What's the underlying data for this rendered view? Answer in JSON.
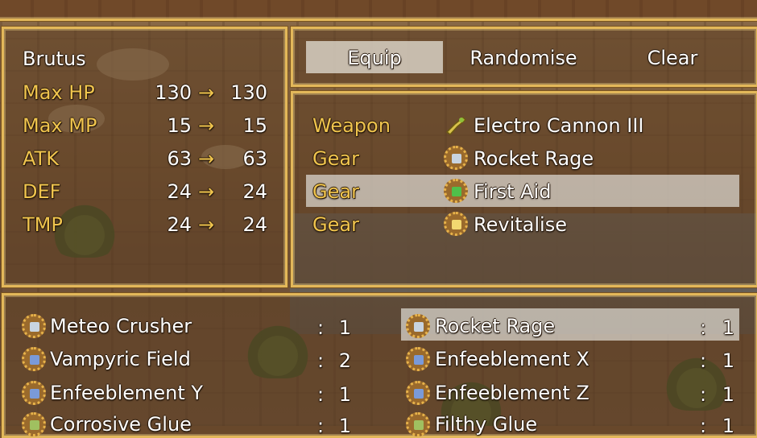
{
  "actor": {
    "name": "Brutus",
    "stats": [
      {
        "label": "Max HP",
        "current": "130",
        "arrow": "→",
        "new": "130"
      },
      {
        "label": "Max MP",
        "current": "15",
        "arrow": "→",
        "new": "15"
      },
      {
        "label": "ATK",
        "current": "63",
        "arrow": "→",
        "new": "63"
      },
      {
        "label": "DEF",
        "current": "24",
        "arrow": "→",
        "new": "24"
      },
      {
        "label": "TMP",
        "current": "24",
        "arrow": "→",
        "new": "24"
      }
    ]
  },
  "commands": [
    {
      "label": "Equip",
      "selected": true
    },
    {
      "label": "Randomise"
    },
    {
      "label": "Clear"
    }
  ],
  "slots": [
    {
      "slot": "Weapon",
      "item": "Electro Cannon III",
      "icon": "blaster-icon"
    },
    {
      "slot": "Gear",
      "item": "Rocket Rage",
      "icon": "gear-shield-icon"
    },
    {
      "slot": "Gear",
      "item": "First Aid",
      "icon": "gear-cross-icon",
      "selected": true
    },
    {
      "slot": "Gear",
      "item": "Revitalise",
      "icon": "gear-heal-icon"
    }
  ],
  "inventory": [
    {
      "name": "Meteo Crusher",
      "sep": ":",
      "qty": "1",
      "icon": "gear-shield-icon"
    },
    {
      "name": "Rocket Rage",
      "sep": ":",
      "qty": "1",
      "icon": "gear-shield-icon",
      "selected": true
    },
    {
      "name": "Vampyric Field",
      "sep": ":",
      "qty": "2",
      "icon": "gear-swirl-icon"
    },
    {
      "name": "Enfeeblement X",
      "sep": ":",
      "qty": "1",
      "icon": "gear-swirl-icon"
    },
    {
      "name": "Enfeeblement Y",
      "sep": ":",
      "qty": "1",
      "icon": "gear-swirl-icon"
    },
    {
      "name": "Enfeeblement Z",
      "sep": ":",
      "qty": "1",
      "icon": "gear-swirl-icon"
    },
    {
      "name": "Corrosive Glue",
      "sep": ":",
      "qty": "1",
      "icon": "gear-glue-icon"
    },
    {
      "name": "Filthy Glue",
      "sep": ":",
      "qty": "1",
      "icon": "gear-glue-icon"
    }
  ],
  "colors": {
    "frame": "#e3b85a",
    "label": "#f0c54e",
    "text": "#ffffff",
    "highlight": "#e1ded7"
  }
}
